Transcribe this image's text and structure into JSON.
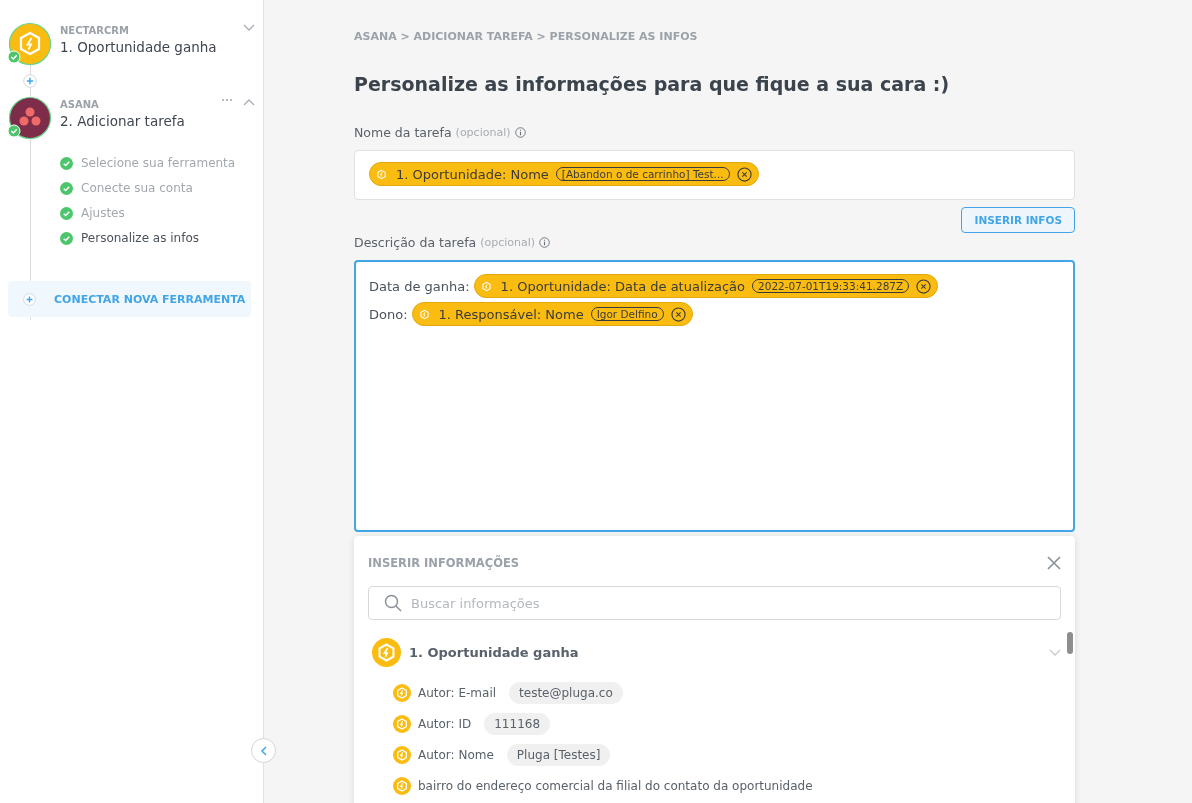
{
  "sidebar": {
    "steps": [
      {
        "kind": "nectar",
        "app": "NECTARCRM",
        "title": "1. Oportunidade ganha",
        "done": true,
        "expanded": false
      },
      {
        "kind": "asana",
        "app": "ASANA",
        "title": "2. Adicionar tarefa",
        "done": true,
        "expanded": true,
        "substeps": [
          {
            "label": "Selecione sua ferramenta",
            "done": true,
            "selected": false
          },
          {
            "label": "Conecte sua conta",
            "done": true,
            "selected": false
          },
          {
            "label": "Ajustes",
            "done": true,
            "selected": false
          },
          {
            "label": "Personalize as infos",
            "done": true,
            "selected": true
          }
        ]
      }
    ],
    "connect_button": "CONECTAR NOVA FERRAMENTA"
  },
  "breadcrumb": "ASANA > ADICIONAR TAREFA > PERSONALIZE AS INFOS",
  "heading": "Personalize as informações para que fique a sua cara :)",
  "fields": [
    {
      "label": "Nome da tarefa",
      "optional": "(opcional)",
      "focused": false,
      "lines": [
        {
          "chips": [
            {
              "label": "1. Oportunidade: Nome",
              "value": "[Abandon o de carrinho] Test..."
            }
          ]
        }
      ]
    },
    {
      "label": "Descrição da tarefa",
      "optional": "(opcional)",
      "focused": true,
      "lines": [
        {
          "prefix": "Data de ganha:",
          "chips": [
            {
              "label": "1. Oportunidade: Data de atualização",
              "value": "2022-07-01T19:33:41.287Z"
            }
          ]
        },
        {
          "prefix": "Dono:",
          "chips": [
            {
              "label": "1. Responsável: Nome",
              "value": "Igor Delfino"
            }
          ]
        }
      ]
    }
  ],
  "insert_button": "INSERIR INFOS",
  "panel": {
    "title": "INSERIR INFORMAÇÕES",
    "search_placeholder": "Buscar informações",
    "group": {
      "title": "1. Oportunidade ganha",
      "items": [
        {
          "label": "Autor: E-mail",
          "value": "teste@pluga.co"
        },
        {
          "label": "Autor: ID",
          "value": "111168"
        },
        {
          "label": "Autor: Nome",
          "value": "Pluga [Testes]"
        },
        {
          "label": "bairro do endereço comercial da filial do contato da oportunidade"
        }
      ]
    }
  }
}
